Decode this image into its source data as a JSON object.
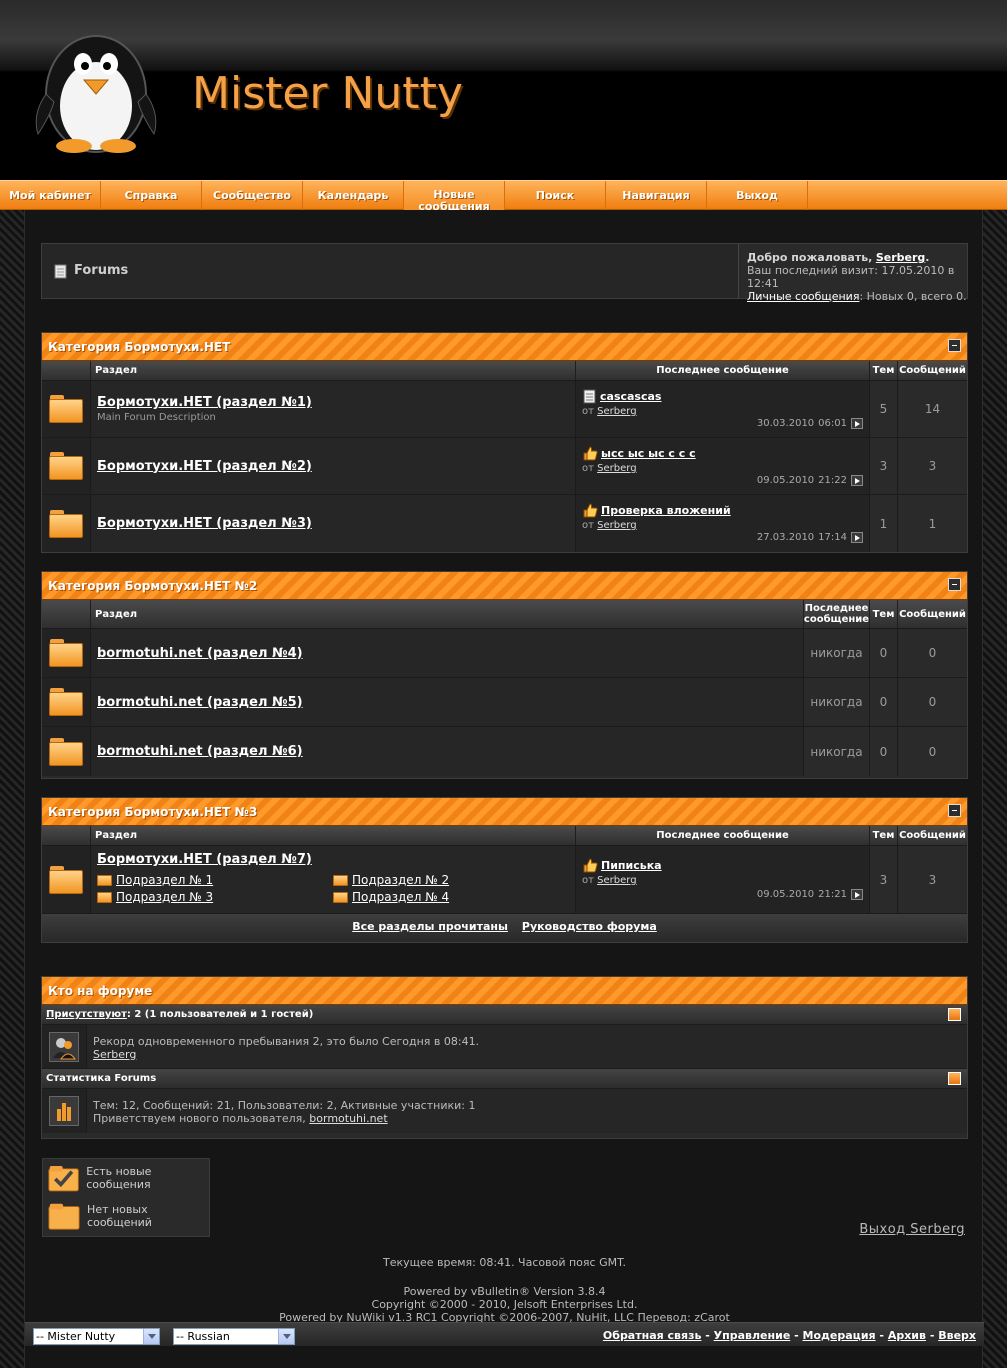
{
  "site": {
    "logo_text": "Mister Nutty"
  },
  "nav": [
    {
      "label": "Мой кабинет"
    },
    {
      "label": "Справка"
    },
    {
      "label": "Сообщество"
    },
    {
      "label": "Календарь"
    },
    {
      "label": "Новые сообщения"
    },
    {
      "label": "Поиск"
    },
    {
      "label": "Навигация"
    },
    {
      "label": "Выход"
    }
  ],
  "breadcrumb": {
    "title": "Forums"
  },
  "welcome": {
    "greeting": "Добро пожаловать,",
    "user": "Serberg",
    "last_visit": "Ваш последний визит: 17.05.2010 в 12:41",
    "pm_link": "Личные сообщения",
    "pm_stats": ": Новых 0, всего 0."
  },
  "colors": {
    "accent": "#f08216",
    "accent_light": "#ffb45a",
    "background": "#151515",
    "panel": "#2a2a2a"
  },
  "table_headers": {
    "icon": "",
    "forum": "Раздел",
    "last_post": "Последнее сообщение",
    "threads": "Тем",
    "posts": "Сообщений"
  },
  "categories": [
    {
      "title": "Категория Бормотухи.НЕТ",
      "forums": [
        {
          "title": "Бормотухи.НЕТ (раздел №1)",
          "desc": "Main Forum Description",
          "last_icon": "document-icon",
          "last_title": "cascascas",
          "by": "от",
          "author": "Serberg",
          "date": "30.03.2010",
          "time": "06:01",
          "threads": "5",
          "posts": "14"
        },
        {
          "title": "Бормотухи.НЕТ (раздел №2)",
          "desc": "",
          "last_icon": "thumbs-up-icon",
          "last_title": "ысс ыс ыс с с с",
          "by": "от",
          "author": "Serberg",
          "date": "09.05.2010",
          "time": "21:22",
          "threads": "3",
          "posts": "3"
        },
        {
          "title": "Бормотухи.НЕТ (раздел №3)",
          "desc": "",
          "last_icon": "thumbs-up-icon",
          "last_title": "Проверка вложений",
          "by": "от",
          "author": "Serberg",
          "date": "27.03.2010",
          "time": "17:14",
          "threads": "1",
          "posts": "1"
        }
      ]
    },
    {
      "title": "Категория Бормотухи.НЕТ №2",
      "last_header": "Последнее сообщение",
      "forums": [
        {
          "title": "bormotuhi.net (раздел №4)",
          "last": "никогда",
          "threads": "0",
          "posts": "0"
        },
        {
          "title": "bormotuhi.net (раздел №5)",
          "last": "никогда",
          "threads": "0",
          "posts": "0"
        },
        {
          "title": "bormotuhi.net (раздел №6)",
          "last": "никогда",
          "threads": "0",
          "posts": "0"
        }
      ]
    },
    {
      "title": "Категория Бормотухи.НЕТ №3",
      "forums": [
        {
          "title": "Бормотухи.НЕТ (раздел №7)",
          "subforums": [
            "Подраздел № 1",
            "Подраздел № 2",
            "Подраздел № 3",
            "Подраздел № 4"
          ],
          "last_icon": "thumbs-up-icon",
          "last_title": "Пиписька",
          "by": "от",
          "author": "Serberg",
          "date": "09.05.2010",
          "time": "21:21",
          "threads": "3",
          "posts": "3"
        }
      ]
    }
  ],
  "bottom_links": {
    "mark_read": "Все разделы прочитаны",
    "forum_leaders": "Руководство форума"
  },
  "whos_online": {
    "title": "Кто на форуме",
    "present_label": "Присутствуют",
    "present_value": ": 2 (1 пользователей и 1 гостей)",
    "record": "Рекорд одновременного пребывания 2, это было Сегодня в 08:41.",
    "online_user": "Serberg",
    "stats_title": "Статистика Forums",
    "stats_line": "Тем: 12, Сообщений: 21, Пользователи: 2, Активные участники: 1",
    "welcome_new": "Приветствуем нового пользователя,",
    "new_user": "bormotuhi.net"
  },
  "legend": {
    "new_posts": "Есть новые сообщения",
    "no_new_posts": "Нет новых сообщений"
  },
  "logout_link": "Выход Serberg",
  "footer": {
    "current_time": "Текущее время: 08:41. Часовой пояс GMT.",
    "powered1": "Powered by vBulletin® Version 3.8.4",
    "copyright": "Copyright ©2000 - 2010, Jelsoft Enterprises Ltd.",
    "powered2_prefix": "Powered by NuWiki v1.3 RC1 Copyright ©2006-2007, NuHit, LLC Перевод:",
    "translator": "zCarot",
    "style_select": "-- Mister Nutty",
    "lang_select": "-- Russian",
    "links": [
      "Обратная связь",
      "Управление",
      "Модерация",
      "Архив",
      "Вверх"
    ],
    "separator": " - "
  }
}
